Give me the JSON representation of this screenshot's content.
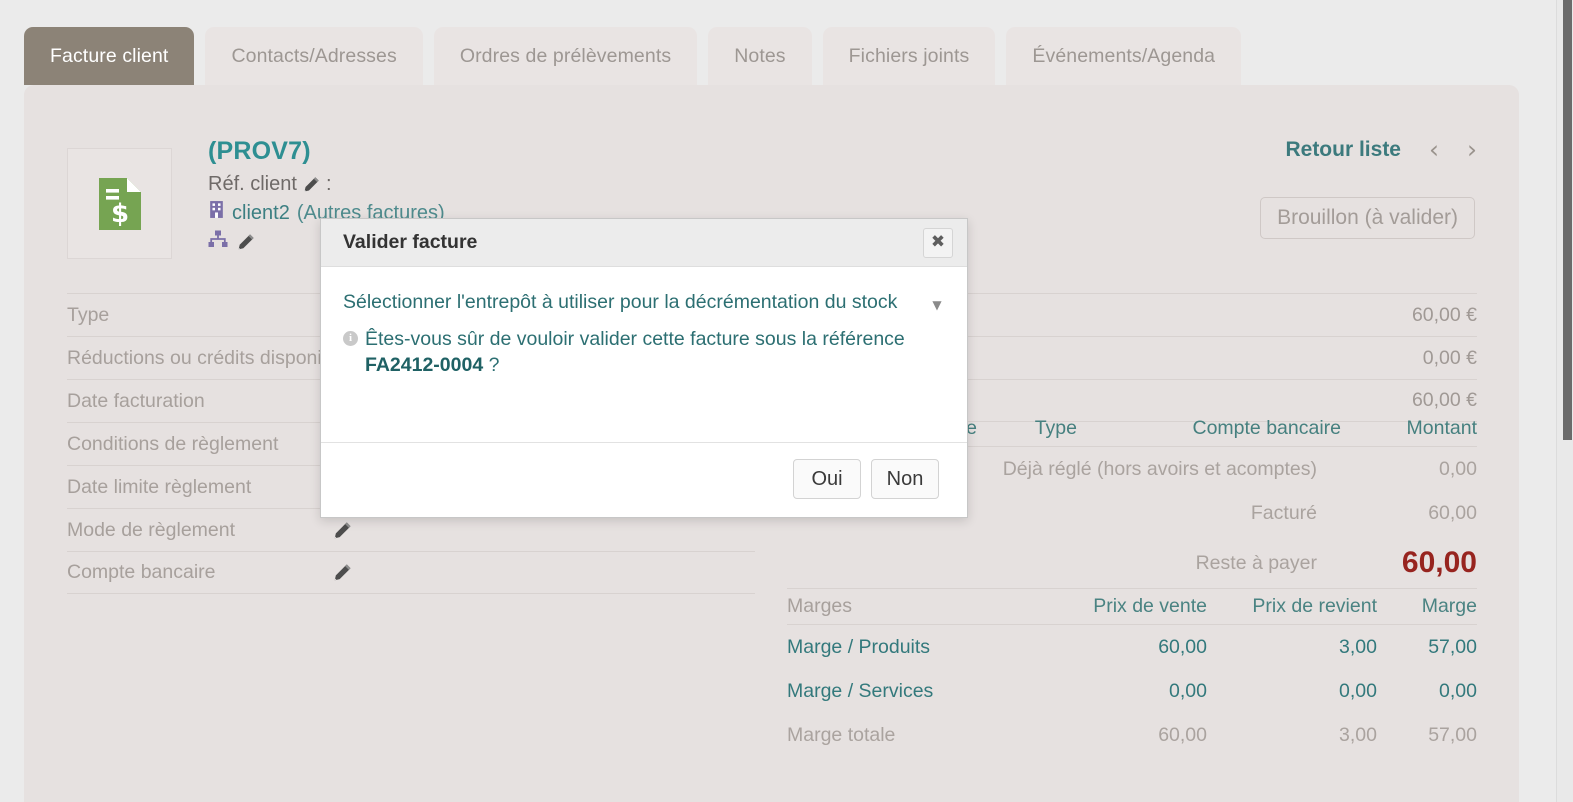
{
  "tabs": [
    {
      "label": "Facture client",
      "active": true
    },
    {
      "label": "Contacts/Adresses",
      "active": false
    },
    {
      "label": "Ordres de prélèvements",
      "active": false
    },
    {
      "label": "Notes",
      "active": false
    },
    {
      "label": "Fichiers joints",
      "active": false
    },
    {
      "label": "Événements/Agenda",
      "active": false
    }
  ],
  "header": {
    "doc_icon": "invoice-dollar-icon",
    "title": "(PROV7)",
    "ref_label": "Réf. client",
    "ref_separator": ":",
    "ref_edit_icon": "pencil-icon",
    "company_icon": "building-icon",
    "client_name": "client2",
    "client_suffix": "(Autres factures)",
    "sitemap_icon": "sitemap-icon",
    "client_edit_icon": "pencil-icon",
    "back_to_list": "Retour liste",
    "prev_icon": "chevron-left-icon",
    "next_icon": "chevron-right-icon",
    "status": "Brouillon (à valider)"
  },
  "form": {
    "rows": [
      {
        "label": "Type",
        "pencil": false
      },
      {
        "label": "Réductions ou crédits disponibles",
        "pencil": false
      },
      {
        "label": "Date facturation",
        "pencil": false
      },
      {
        "label": "Conditions de règlement",
        "pencil": false
      },
      {
        "label": "Date limite règlement",
        "pencil": false
      },
      {
        "label": "Mode de règlement",
        "pencil": true
      },
      {
        "label": "Compte bancaire",
        "pencil": true
      }
    ]
  },
  "amounts": {
    "rows": [
      "60,00 €",
      "0,00 €",
      "60,00 €"
    ]
  },
  "payments": {
    "columns": [
      "Date",
      "Type",
      "Compte bancaire",
      "Montant"
    ],
    "rows": [
      {
        "label": "Déjà réglé (hors avoirs et acomptes)",
        "amount": "0,00",
        "total": false
      },
      {
        "label": "Facturé",
        "amount": "60,00",
        "total": false
      },
      {
        "label": "Reste à payer",
        "amount": "60,00",
        "total": true
      }
    ]
  },
  "margins": {
    "columns": [
      "Marges",
      "Prix de vente",
      "Prix de revient",
      "Marge"
    ],
    "rows": [
      {
        "label": "Marge / Produits",
        "vente": "60,00",
        "revient": "3,00",
        "marge": "57,00",
        "muted": false
      },
      {
        "label": "Marge / Services",
        "vente": "0,00",
        "revient": "0,00",
        "marge": "0,00",
        "muted": false
      },
      {
        "label": "Marge totale",
        "vente": "60,00",
        "revient": "3,00",
        "marge": "57,00",
        "muted": true
      }
    ]
  },
  "modal": {
    "title": "Valider facture",
    "close_icon": "close-icon",
    "select_label": "Sélectionner l'entrepôt à utiliser pour la décrémentation du stock",
    "select_caret_icon": "chevron-down-icon",
    "info_icon": "info-icon",
    "info_glyph": "i",
    "confirm_prefix": "Êtes-vous sûr de vouloir valider cette facture sous la référence ",
    "confirm_reference": "FA2412-0004",
    "confirm_suffix": " ?",
    "yes_label": "Oui",
    "no_label": "Non"
  },
  "colors": {
    "page_bg": "#ebebeb",
    "card_bg": "#e6e1e0",
    "tab_active_bg": "#8c8377",
    "teal": "#2e8f92",
    "danger_red": "#97241f",
    "icon_green": "#76a452",
    "icon_purple": "#7b6fa8"
  }
}
